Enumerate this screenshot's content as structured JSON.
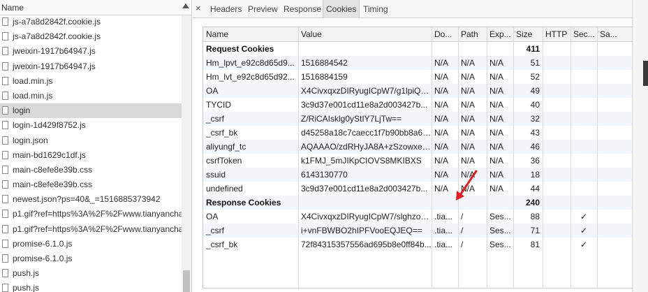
{
  "left_panel": {
    "header": "Name",
    "files": [
      {
        "name": "js-a7a8d2842f.cookie.js"
      },
      {
        "name": "js-a7a8d2842f.cookie.js"
      },
      {
        "name": "jweixin-1917b64947.js"
      },
      {
        "name": "jweixin-1917b64947.js"
      },
      {
        "name": "load.min.js"
      },
      {
        "name": "load.min.js"
      },
      {
        "name": "login"
      },
      {
        "name": "login-1d429f8752.js"
      },
      {
        "name": "login.json"
      },
      {
        "name": "main-bd1629c1df.js"
      },
      {
        "name": "main-c8efe8e39b.css"
      },
      {
        "name": "main-c8efe8e39b.css"
      },
      {
        "name": "newest.json?ps=40&_=1516885373942"
      },
      {
        "name": "p1.gif?ref=https%3A%2F%2Fwww.tianyancha."
      },
      {
        "name": "p1.gif?ref=https%3A%2F%2Fwww.tianyancha."
      },
      {
        "name": "promise-6.1.0.js"
      },
      {
        "name": "promise-6.1.0.js"
      },
      {
        "name": "push.js"
      },
      {
        "name": "push.js"
      }
    ],
    "selected_index": 6
  },
  "tabs": {
    "close_glyph": "×",
    "items": [
      "Headers",
      "Preview",
      "Response",
      "Cookies",
      "Timing"
    ],
    "active": "Cookies"
  },
  "cookies_table": {
    "columns": [
      "Name",
      "Value",
      "Do...",
      "Path",
      "Exp...",
      "Size",
      "HTTP",
      "Sec...",
      "Sa..."
    ],
    "request_section": {
      "label": "Request Cookies",
      "size": "411"
    },
    "request_cookies": [
      {
        "name": "Hm_lpvt_e92c8d65d9...",
        "value": "1516884542",
        "domain": "N/A",
        "path": "N/A",
        "expires": "N/A",
        "size": "51",
        "http": "",
        "secure": "",
        "samesite": ""
      },
      {
        "name": "Hm_lvt_e92c8d65d92...",
        "value": "1516884159",
        "domain": "N/A",
        "path": "N/A",
        "expires": "N/A",
        "size": "52",
        "http": "",
        "secure": "",
        "samesite": ""
      },
      {
        "name": "OA",
        "value": "X4CivxqxzDIRyugICpW7/g1lpiQR...",
        "domain": "N/A",
        "path": "N/A",
        "expires": "N/A",
        "size": "49",
        "http": "",
        "secure": "",
        "samesite": ""
      },
      {
        "name": "TYCID",
        "value": "3c9d37e001cd11e8a2d003427b...",
        "domain": "N/A",
        "path": "N/A",
        "expires": "N/A",
        "size": "40",
        "http": "",
        "secure": "",
        "samesite": ""
      },
      {
        "name": "_csrf",
        "value": "Z/RiCAIsklg0yStIY7LjTw==",
        "domain": "N/A",
        "path": "N/A",
        "expires": "N/A",
        "size": "32",
        "http": "",
        "secure": "",
        "samesite": ""
      },
      {
        "name": "_csrf_bk",
        "value": "d45258a18c7caecc1f7b90bb8a6f...",
        "domain": "N/A",
        "path": "N/A",
        "expires": "N/A",
        "size": "43",
        "http": "",
        "secure": "",
        "samesite": ""
      },
      {
        "name": "aliyungf_tc",
        "value": "AQAAAO/zdRHyJA8A+zSzowxe9...",
        "domain": "N/A",
        "path": "N/A",
        "expires": "N/A",
        "size": "46",
        "http": "",
        "secure": "",
        "samesite": ""
      },
      {
        "name": "csrfToken",
        "value": "k1FMJ_5mJIKpCIOVS8MKIBXS",
        "domain": "N/A",
        "path": "N/A",
        "expires": "N/A",
        "size": "36",
        "http": "",
        "secure": "",
        "samesite": ""
      },
      {
        "name": "ssuid",
        "value": "6143130770",
        "domain": "N/A",
        "path": "N/A",
        "expires": "N/A",
        "size": "18",
        "http": "",
        "secure": "",
        "samesite": ""
      },
      {
        "name": "undefined",
        "value": "3c9d37e001cd11e8a2d003427b...",
        "domain": "N/A",
        "path": "N/A",
        "expires": "N/A",
        "size": "44",
        "http": "",
        "secure": "",
        "samesite": ""
      }
    ],
    "response_section": {
      "label": "Response Cookies",
      "size": "240"
    },
    "response_cookies": [
      {
        "name": "OA",
        "value": "X4CivxqxzDIRyugICpW7/slghzoe...",
        "domain": ".tia...",
        "path": "/",
        "expires": "Ses...",
        "size": "88",
        "http": "",
        "secure": "✓",
        "samesite": ""
      },
      {
        "name": "_csrf",
        "value": "i+vnFBWBO2hIPFVooEQJEQ==",
        "domain": ".tia...",
        "path": "/",
        "expires": "Ses...",
        "size": "71",
        "http": "",
        "secure": "✓",
        "samesite": ""
      },
      {
        "name": "_csrf_bk",
        "value": "72f84315357556ad695b8e0ff84b...",
        "domain": ".tia...",
        "path": "/",
        "expires": "Ses...",
        "size": "81",
        "http": "",
        "secure": "✓",
        "samesite": ""
      }
    ]
  },
  "colors": {
    "selected_row": "#d9d9d9",
    "stripe": "#f2f6fa",
    "arrow": "#e02020"
  }
}
